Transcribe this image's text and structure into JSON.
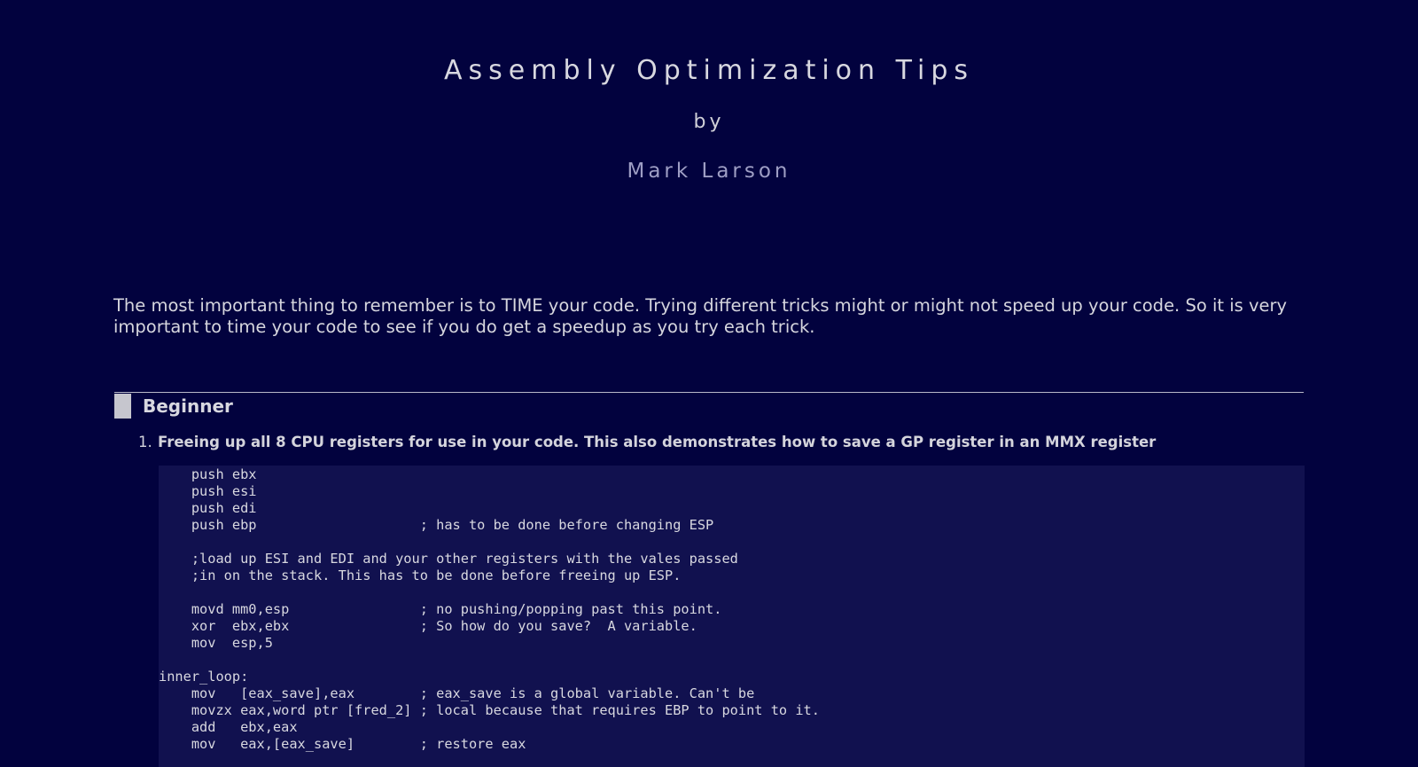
{
  "header": {
    "title": "Assembly Optimization Tips",
    "by": "by",
    "author": "Mark Larson"
  },
  "intro": "The most important thing to remember is to TIME your code. Trying different tricks might or might not speed up your code. So it is very important to time your code to see if you do get a speedup as you try each trick.",
  "section": {
    "title": "Beginner"
  },
  "tip": {
    "number": "1.",
    "heading": "Freeing up all 8 CPU registers for use in your code. This also demonstrates how to save a GP register in an MMX register",
    "code": "    push ebx\n    push esi\n    push edi\n    push ebp                    ; has to be done before changing ESP\n\n    ;load up ESI and EDI and your other registers with the vales passed\n    ;in on the stack. This has to be done before freeing up ESP.\n\n    movd mm0,esp                ; no pushing/popping past this point.\n    xor  ebx,ebx                ; So how do you save?  A variable.\n    mov  esp,5\n\ninner_loop:\n    mov   [eax_save],eax        ; eax_save is a global variable. Can't be\n    movzx eax,word ptr [fred_2] ; local because that requires EBP to point to it.\n    add   ebx,eax\n    mov   eax,[eax_save]        ; restore eax"
  },
  "colors": {
    "background": "#02023e",
    "code_background": "#11114f",
    "author": "#9e9ec4"
  }
}
